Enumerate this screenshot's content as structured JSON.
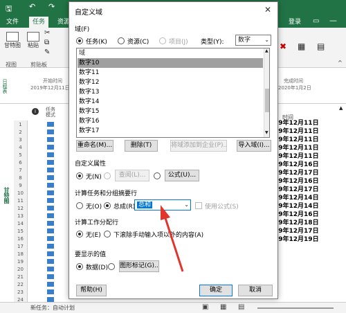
{
  "ribbon": {
    "tabs": [
      "文件",
      "任务",
      "资源"
    ],
    "login": "登录",
    "view_btn": "甘特图",
    "paste_btn": "粘贴",
    "group_view": "视图",
    "group_clipboard": "剪贴板"
  },
  "timeline": {
    "start_label": "开始时间",
    "start_date": "2019年12月11日",
    "end_label": "完成时间",
    "end_date": "2020年1月2日",
    "side_label": "日程表"
  },
  "grid": {
    "col_mode": "任务模式",
    "side_label": "甘特图",
    "row_numbers": [
      "1",
      "2",
      "3",
      "4",
      "5",
      "6",
      "7",
      "8",
      "9",
      "10",
      "11",
      "12",
      "13",
      "14",
      "15",
      "16",
      "17",
      "18",
      "19",
      "20",
      "21",
      "22",
      "23",
      "24"
    ],
    "date_header": "时间",
    "dates": [
      "19年12月11日",
      "19年12月11日",
      "19年12月11日",
      "19年12月11日",
      "19年12月11日",
      "19年12月16日",
      "19年12月17日",
      "19年12月16日",
      "19年12月17日",
      "19年12月14日",
      "19年12月14日",
      "19年12月16日",
      "19年12月18日",
      "19年12月17日",
      "19年12月19日"
    ]
  },
  "status": {
    "new_task": "新任务：自动计划"
  },
  "dialog": {
    "title": "自定义域",
    "close": "✕",
    "section_field": "域(F)",
    "radio_task": "任务(K)",
    "radio_resource": "资源(C)",
    "radio_project": "项目(J)",
    "type_label": "类型(Y):",
    "type_value": "数字",
    "list_header": "域",
    "list_items": [
      "数字10",
      "数字11",
      "数字12",
      "数字13",
      "数字14",
      "数字15",
      "数字16",
      "数字17"
    ],
    "btn_rename": "重命名(M)...",
    "btn_delete": "删除(T)",
    "btn_add_enterprise": "将域添加到企业(P)...",
    "btn_import": "导入域(I)...",
    "section_attr": "自定义属性",
    "radio_none_n": "无(N)",
    "btn_lookup": "查阅(L)...",
    "btn_formula": "公式(U)...",
    "section_rollup": "计算任务和分组摘要行",
    "radio_none_o": "无(O)",
    "radio_summary": "总成(R):",
    "rollup_value": "总和",
    "use_formula": "使用公式(S)",
    "section_assign": "计算工作分配行",
    "radio_none_e": "无(E)",
    "radio_rollup_down": "下滚除手动输入项以外的内容(A)",
    "section_display": "要显示的值",
    "radio_data": "数据(D)",
    "btn_graphic": "图形标记(G)...",
    "btn_help": "帮助(H)",
    "btn_ok": "确定",
    "btn_cancel": "取消"
  },
  "colors": {
    "ribbon_green": "#217346",
    "annotation_arrow": "#e0352b",
    "focus_blue": "#0078d7"
  }
}
